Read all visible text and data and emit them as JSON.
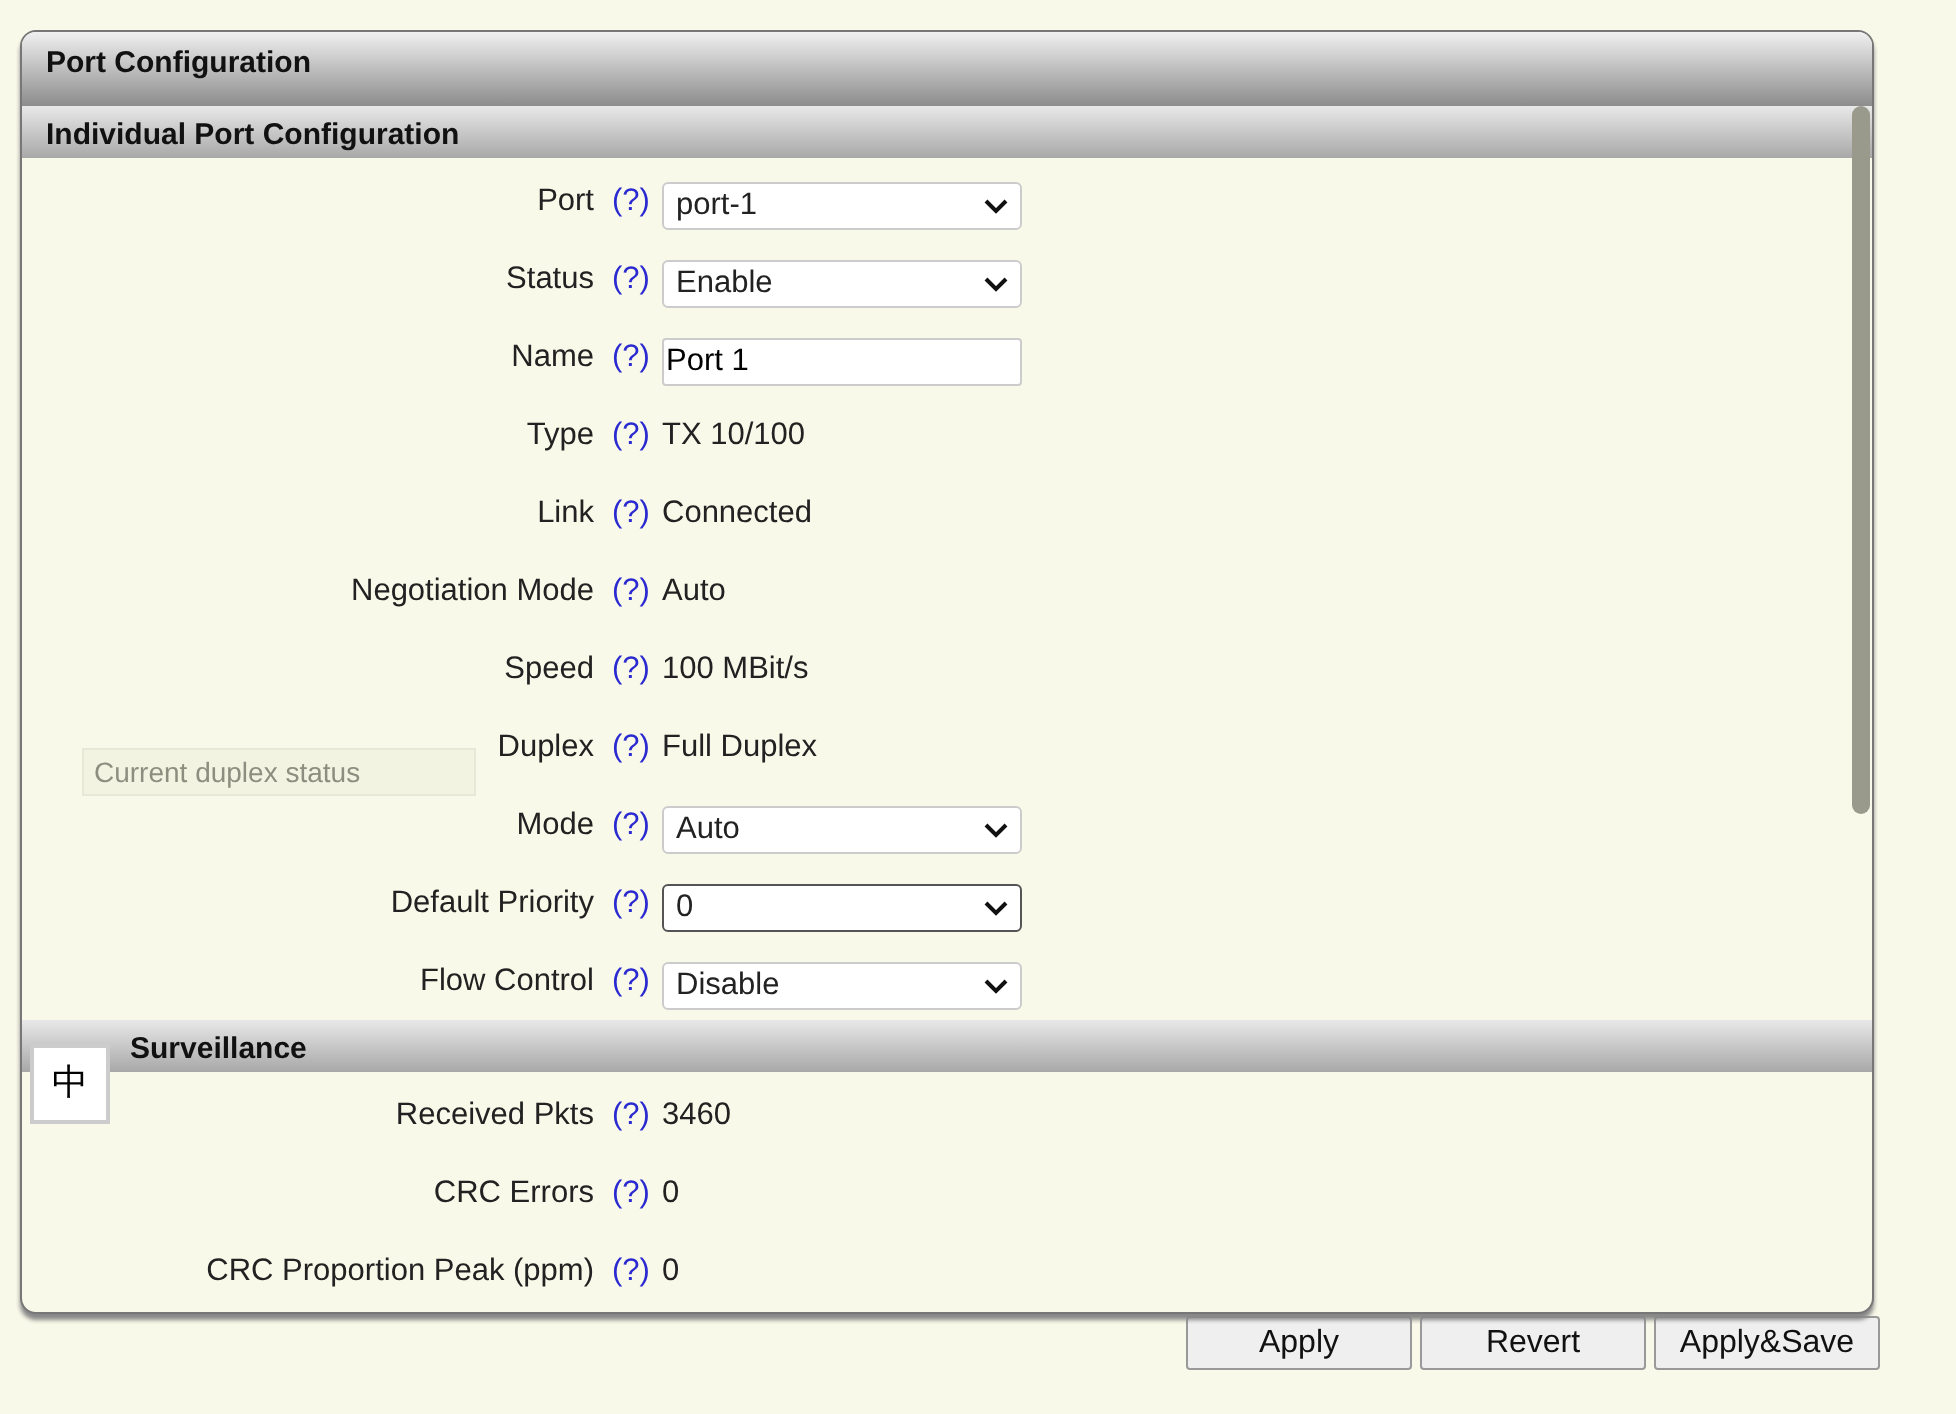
{
  "panel": {
    "title": "Port Configuration"
  },
  "sections": [
    {
      "title": "Individual Port Configuration",
      "rows": [
        {
          "label": "Port",
          "help": "(?)",
          "kind": "select",
          "value": "port-1",
          "focused": false
        },
        {
          "label": "Status",
          "help": "(?)",
          "kind": "select",
          "value": "Enable",
          "focused": false
        },
        {
          "label": "Name",
          "help": "(?)",
          "kind": "input",
          "value": "Port 1"
        },
        {
          "label": "Type",
          "help": "(?)",
          "kind": "text",
          "value": "TX 10/100"
        },
        {
          "label": "Link",
          "help": "(?)",
          "kind": "text",
          "value": "Connected"
        },
        {
          "label": "Negotiation Mode",
          "help": "(?)",
          "kind": "text",
          "value": "Auto"
        },
        {
          "label": "Speed",
          "help": "(?)",
          "kind": "text",
          "value": "100 MBit/s"
        },
        {
          "label": "Duplex",
          "help": "(?)",
          "kind": "text",
          "value": "Full Duplex"
        },
        {
          "label": "Mode",
          "help": "(?)",
          "kind": "select",
          "value": "Auto",
          "focused": false
        },
        {
          "label": "Default Priority",
          "help": "(?)",
          "kind": "select",
          "value": "0",
          "focused": true
        },
        {
          "label": "Flow Control",
          "help": "(?)",
          "kind": "select",
          "value": "Disable",
          "focused": false
        }
      ]
    },
    {
      "title": "Surveillance",
      "rows": [
        {
          "label": "Received Pkts",
          "help": "(?)",
          "kind": "text",
          "value": "3460"
        },
        {
          "label": "CRC Errors",
          "help": "(?)",
          "kind": "text",
          "value": "0"
        },
        {
          "label": "CRC Proportion Peak (ppm)",
          "help": "(?)",
          "kind": "text",
          "value": "0"
        }
      ]
    }
  ],
  "tooltip": {
    "text": "Current duplex status"
  },
  "ime_badge": {
    "text": "中"
  },
  "buttons": [
    "Apply",
    "Revert",
    "Apply&Save"
  ]
}
